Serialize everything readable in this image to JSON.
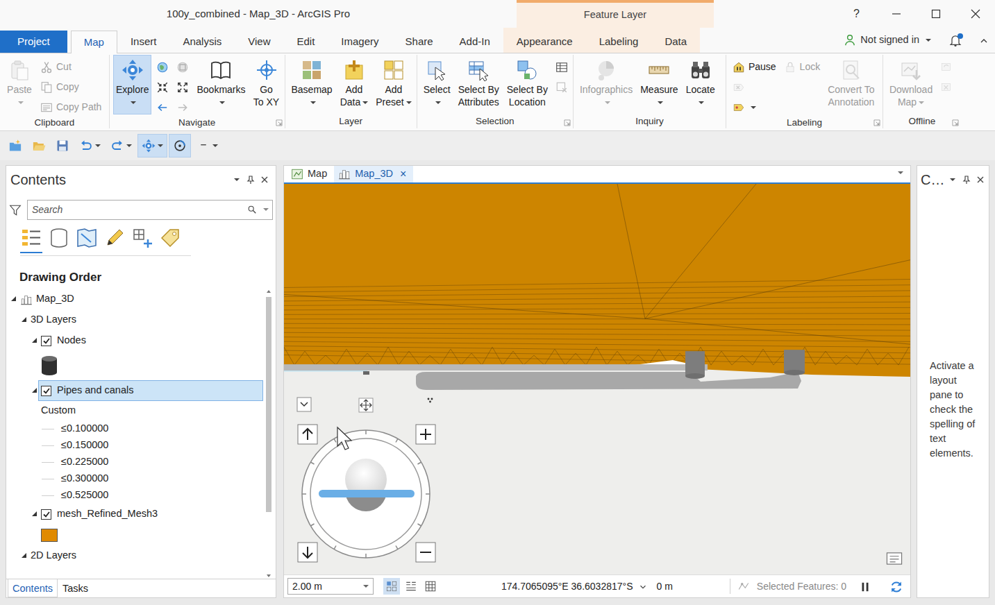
{
  "window": {
    "title": "100y_combined - Map_3D - ArcGIS Pro",
    "contextual_group": "Feature Layer",
    "help": "?"
  },
  "ribbon_tabs": [
    {
      "label": "Project",
      "kind": "backstage",
      "selected": false
    },
    {
      "label": "Map",
      "kind": "standard",
      "selected": true
    },
    {
      "label": "Insert",
      "kind": "standard",
      "selected": false
    },
    {
      "label": "Analysis",
      "kind": "standard",
      "selected": false
    },
    {
      "label": "View",
      "kind": "standard",
      "selected": false
    },
    {
      "label": "Edit",
      "kind": "standard",
      "selected": false
    },
    {
      "label": "Imagery",
      "kind": "standard",
      "selected": false
    },
    {
      "label": "Share",
      "kind": "standard",
      "selected": false
    },
    {
      "label": "Add-In",
      "kind": "standard",
      "selected": false
    },
    {
      "label": "Appearance",
      "kind": "contextual",
      "selected": false
    },
    {
      "label": "Labeling",
      "kind": "contextual",
      "selected": false
    },
    {
      "label": "Data",
      "kind": "contextual",
      "selected": false
    }
  ],
  "account": {
    "label": "Not signed in",
    "notification": true
  },
  "ribbon_groups": [
    {
      "label": "Clipboard",
      "launcher": false,
      "controls": [
        {
          "kind": "large",
          "lines": [
            "Paste"
          ],
          "dropdown": true,
          "disabled": true,
          "selected": false
        },
        {
          "kind": "small",
          "lines": [
            "Cut"
          ],
          "dropdown": false,
          "disabled": true,
          "selected": false
        },
        {
          "kind": "small",
          "lines": [
            "Copy"
          ],
          "dropdown": false,
          "disabled": true,
          "selected": false
        },
        {
          "kind": "small",
          "lines": [
            "Copy Path"
          ],
          "dropdown": false,
          "disabled": true,
          "selected": false
        }
      ]
    },
    {
      "label": "Navigate",
      "launcher": true,
      "controls": [
        {
          "kind": "large",
          "lines": [
            "Explore"
          ],
          "dropdown": true,
          "disabled": false,
          "selected": true
        },
        {
          "kind": "icon",
          "dropdown": false,
          "disabled": false,
          "selected": false
        },
        {
          "kind": "icon",
          "dropdown": false,
          "disabled": false,
          "selected": false
        },
        {
          "kind": "icon",
          "dropdown": false,
          "disabled": false,
          "selected": false
        },
        {
          "kind": "icon",
          "dropdown": false,
          "disabled": true,
          "selected": false
        },
        {
          "kind": "icon",
          "dropdown": false,
          "disabled": false,
          "selected": false
        },
        {
          "kind": "icon",
          "dropdown": false,
          "disabled": true,
          "selected": false
        },
        {
          "kind": "large",
          "lines": [
            "Bookmarks"
          ],
          "dropdown": true,
          "disabled": false,
          "selected": false
        },
        {
          "kind": "large",
          "lines": [
            "Go",
            "To XY"
          ],
          "dropdown": false,
          "disabled": false,
          "selected": false
        }
      ]
    },
    {
      "label": "Layer",
      "launcher": false,
      "controls": [
        {
          "kind": "large",
          "lines": [
            "Basemap"
          ],
          "dropdown": true,
          "disabled": false,
          "selected": false
        },
        {
          "kind": "large",
          "lines": [
            "Add",
            "Data"
          ],
          "dropdown": true,
          "disabled": false,
          "selected": false
        },
        {
          "kind": "large",
          "lines": [
            "Add",
            "Preset"
          ],
          "dropdown": true,
          "disabled": false,
          "selected": false
        }
      ]
    },
    {
      "label": "Selection",
      "launcher": true,
      "controls": [
        {
          "kind": "large",
          "lines": [
            "Select"
          ],
          "dropdown": true,
          "disabled": false,
          "selected": false
        },
        {
          "kind": "large",
          "lines": [
            "Select By",
            "Attributes"
          ],
          "dropdown": false,
          "disabled": false,
          "selected": false
        },
        {
          "kind": "large",
          "lines": [
            "Select By",
            "Location"
          ],
          "dropdown": false,
          "disabled": false,
          "selected": false
        },
        {
          "kind": "icon",
          "dropdown": false,
          "disabled": false,
          "selected": false
        },
        {
          "kind": "icon",
          "dropdown": false,
          "disabled": true,
          "selected": false
        }
      ]
    },
    {
      "label": "Inquiry",
      "launcher": false,
      "controls": [
        {
          "kind": "large",
          "lines": [
            "Infographics"
          ],
          "dropdown": true,
          "disabled": true,
          "selected": false
        },
        {
          "kind": "large",
          "lines": [
            "Measure"
          ],
          "dropdown": true,
          "disabled": false,
          "selected": false
        },
        {
          "kind": "large",
          "lines": [
            "Locate"
          ],
          "dropdown": true,
          "disabled": false,
          "selected": false
        }
      ]
    },
    {
      "label": "Labeling",
      "launcher": true,
      "controls": [
        {
          "kind": "small",
          "lines": [
            "Pause"
          ],
          "dropdown": false,
          "disabled": false,
          "selected": false
        },
        {
          "kind": "icon",
          "dropdown": false,
          "disabled": true,
          "selected": false
        },
        {
          "kind": "icon",
          "dropdown": true,
          "disabled": false,
          "selected": false
        },
        {
          "kind": "small",
          "lines": [
            "Lock"
          ],
          "dropdown": false,
          "disabled": true,
          "selected": false
        },
        {
          "kind": "large",
          "lines": [
            "Convert To",
            "Annotation"
          ],
          "dropdown": false,
          "disabled": true,
          "selected": false
        }
      ]
    },
    {
      "label": "Offline",
      "launcher": true,
      "controls": [
        {
          "kind": "large",
          "lines": [
            "Download",
            "Map"
          ],
          "dropdown": true,
          "disabled": true,
          "selected": false
        },
        {
          "kind": "icon",
          "dropdown": false,
          "disabled": true,
          "selected": false
        },
        {
          "kind": "icon",
          "dropdown": false,
          "disabled": true,
          "selected": false
        }
      ]
    }
  ],
  "quick_access": [
    {
      "selected": false,
      "disabled": false,
      "dropdown": false
    },
    {
      "selected": false,
      "disabled": false,
      "dropdown": false
    },
    {
      "selected": false,
      "disabled": false,
      "dropdown": false
    },
    {
      "selected": false,
      "disabled": false,
      "dropdown": true
    },
    {
      "selected": false,
      "disabled": true,
      "dropdown": true
    },
    {
      "selected": true,
      "disabled": false,
      "dropdown": true
    },
    {
      "selected": true,
      "disabled": false,
      "dropdown": false
    },
    {
      "selected": false,
      "disabled": false,
      "dropdown": true
    }
  ],
  "contents": {
    "title": "Contents",
    "search_placeholder": "Search",
    "views": [
      {
        "selected": true
      },
      {
        "selected": false
      },
      {
        "selected": false
      },
      {
        "selected": false
      },
      {
        "selected": false
      },
      {
        "selected": false
      }
    ],
    "heading": "Drawing Order",
    "tree": [
      {
        "label": "Map_3D",
        "kind": "map",
        "level": 0,
        "expanded": true,
        "selected": false
      },
      {
        "label": "3D Layers",
        "kind": "group",
        "level": 1,
        "expanded": true,
        "selected": false
      },
      {
        "label": "Nodes",
        "kind": "layer",
        "level": 2,
        "expanded": true,
        "checked": true,
        "selected": false
      },
      {
        "kind": "cylinder",
        "level": 2,
        "selected": false
      },
      {
        "label": "Pipes and canals",
        "kind": "layer",
        "level": 2,
        "expanded": true,
        "checked": true,
        "selected": true
      },
      {
        "label": "Custom",
        "kind": "heading",
        "level": 2,
        "selected": false
      },
      {
        "label": "≤0.100000",
        "kind": "legend",
        "level": 2,
        "selected": false
      },
      {
        "label": "≤0.150000",
        "kind": "legend",
        "level": 2,
        "selected": false
      },
      {
        "label": "≤0.225000",
        "kind": "legend",
        "level": 2,
        "selected": false
      },
      {
        "label": "≤0.300000",
        "kind": "legend",
        "level": 2,
        "selected": false
      },
      {
        "label": "≤0.525000",
        "kind": "legend",
        "level": 2,
        "selected": false
      },
      {
        "label": "mesh_Refined_Mesh3",
        "kind": "layer",
        "level": 2,
        "expanded": true,
        "checked": true,
        "selected": false
      },
      {
        "kind": "swatch",
        "level": 2,
        "selected": false
      },
      {
        "label": "2D Layers",
        "kind": "group",
        "level": 1,
        "expanded": true,
        "selected": false
      }
    ],
    "tabs": [
      {
        "label": "Contents",
        "selected": true
      },
      {
        "label": "Tasks",
        "selected": false
      }
    ]
  },
  "map_tabs": [
    {
      "label": "Map",
      "selected": false
    },
    {
      "label": "Map_3D",
      "selected": true,
      "close": "×"
    }
  ],
  "status_bar": {
    "scale": "2.00 m",
    "coordinates": "174.7065095°E 36.6032817°S",
    "elevation": "0 m",
    "selected_features": "Selected Features: 0"
  },
  "right_pane": {
    "title": "C…",
    "message": "Activate a layout pane to check the spelling of text elements."
  }
}
